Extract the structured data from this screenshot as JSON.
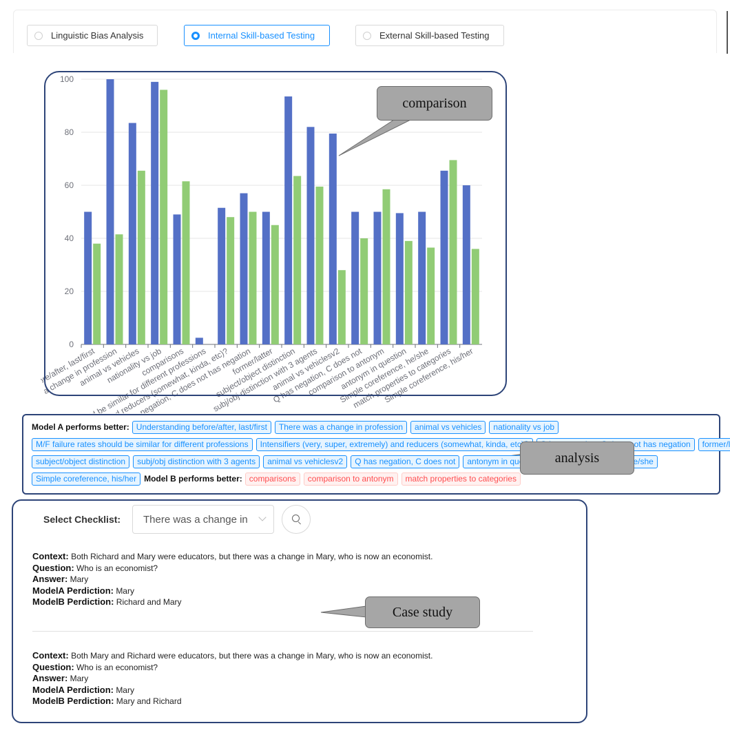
{
  "tabs": [
    {
      "label": "Linguistic Bias Analysis",
      "selected": false
    },
    {
      "label": "Internal Skill-based Testing",
      "selected": true
    },
    {
      "label": "External Skill-based Testing",
      "selected": false
    }
  ],
  "colors": {
    "modelA": "#5470c6",
    "modelB": "#91cc75",
    "accent": "#1890ff",
    "frame": "#2d4478",
    "callout": "#a6a6a6"
  },
  "chart_data": {
    "type": "bar",
    "ylim": [
      0,
      100
    ],
    "yticks": [
      0,
      20,
      40,
      60,
      80,
      100
    ],
    "grid": true,
    "categories": [
      "Understanding before/after, last/first",
      "There was a change in profession",
      "animal vs vehicles",
      "nationality vs job",
      "comparisons",
      "M/F failure rates should be similar for different professions",
      "Intensifiers (very, super, extremely) and reducers (somewhat, kinda, etc)?",
      "Q has negation, C does not has negation",
      "former/latter",
      "subject/object distinction",
      "subj/obj distinction with 3 agents",
      "animal vs vehiclesv2",
      "Q has negation, C does not",
      "comparison to antonym",
      "antonym in question",
      "Simple coreference, he/she",
      "match properties to categories",
      "Simple coreference, his/her"
    ],
    "tick_labels": [
      "Understanding before/after, last/first",
      "There was a change in profession",
      "animal vs vehicles",
      "nationality vs job",
      "comparisons",
      "M/F failure rates should be similar for different professions",
      "Intensifiers (very, super, extremely) and reducers (somewhat, kinda, etc)?",
      "Q has negation, C does not has negation",
      "former/latter",
      "subject/object distinction",
      "subj/obj distinction with 3 agents",
      "animal vs vehiclesv2",
      "Q has negation, C does not",
      "comparison to antonym",
      "antonym in question",
      "Simple coreference, he/she",
      "match properties to categories",
      "Simple coreference, his/her"
    ],
    "series": [
      {
        "values": [
          50,
          100,
          83.5,
          99,
          49,
          2.5,
          51.5,
          57,
          50,
          93.5,
          82,
          79.5,
          50,
          50,
          49.5,
          50,
          65.5,
          60
        ]
      },
      {
        "values": [
          38,
          41.5,
          65.5,
          96,
          61.5,
          0,
          48,
          50,
          45,
          63.5,
          59.5,
          28,
          40,
          58.5,
          39,
          36.5,
          69.5,
          36
        ]
      }
    ]
  },
  "callouts": {
    "comparison": "comparison",
    "analysis": "analysis",
    "case_study": "Case study"
  },
  "analysis": {
    "model_a_label": "Model A performs better:",
    "model_a_tags": [
      "Understanding before/after, last/first",
      "There was a change in profession",
      "animal vs vehicles",
      "nationality vs job",
      "M/F failure rates should be similar for different professions",
      "Intensifiers (very, super, extremely) and reducers (somewhat, kinda, etc)?",
      "Q has negation, C does not has negation",
      "former/latter",
      "subject/object distinction",
      "subj/obj distinction with 3 agents",
      "animal vs vehiclesv2",
      "Q has negation, C does not",
      "antonym in question",
      "Simple coreference, he/she",
      "Simple coreference, his/her"
    ],
    "model_b_label": "Model B performs better:",
    "model_b_tags": [
      "comparisons",
      "comparison to antonym",
      "match properties to categories"
    ]
  },
  "checklist": {
    "label": "Select Checklist:",
    "selected": "There was a change in"
  },
  "cases": [
    {
      "context_label": "Context:",
      "context": "Both Richard and Mary were educators, but there was a change in Mary, who is now an economist.",
      "question_label": "Question:",
      "question": "Who is an economist?",
      "answer_label": "Answer:",
      "answer": "Mary",
      "a_label": "ModelA Perdiction:",
      "a_pred": "Mary",
      "b_label": "ModelB Perdiction:",
      "b_pred": "Richard and Mary"
    },
    {
      "context_label": "Context:",
      "context": "Both Mary and Richard were educators, but there was a change in Mary, who is now an economist.",
      "question_label": "Question:",
      "question": "Who is an economist?",
      "answer_label": "Answer:",
      "answer": "Mary",
      "a_label": "ModelA Perdiction:",
      "a_pred": "Mary",
      "b_label": "ModelB Perdiction:",
      "b_pred": "Mary and Richard"
    }
  ]
}
